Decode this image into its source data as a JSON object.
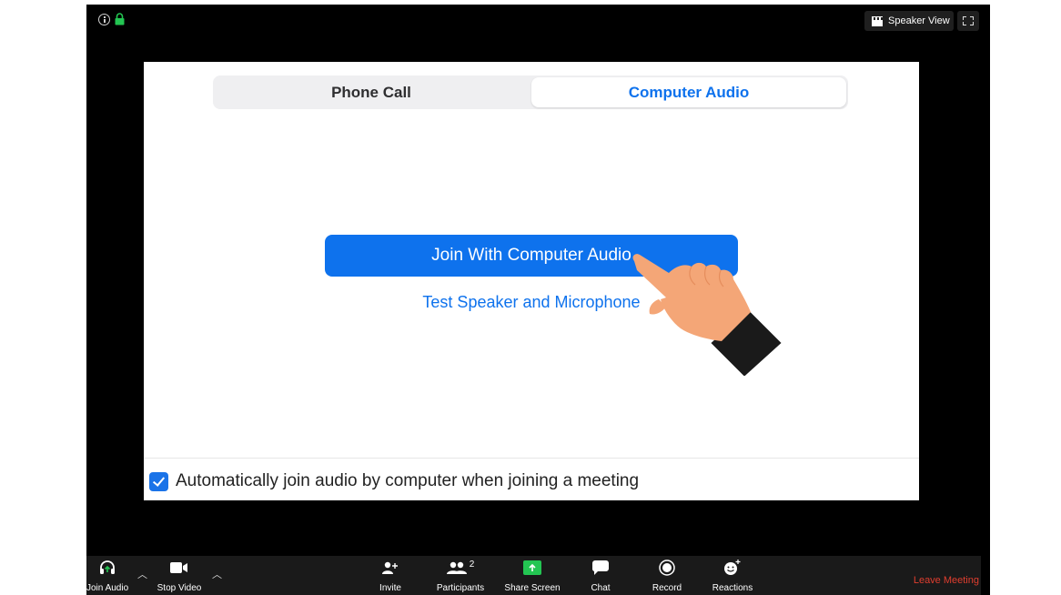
{
  "topbar": {
    "speaker_view_label": "Speaker View"
  },
  "dialog": {
    "tabs": [
      {
        "label": "Phone Call",
        "selected": false
      },
      {
        "label": "Computer Audio",
        "selected": true
      }
    ],
    "join_button_label": "Join With Computer Audio",
    "test_link_label": "Test Speaker and Microphone",
    "auto_join": {
      "checked": true,
      "label": "Automatically join audio by computer when joining a meeting"
    }
  },
  "toolbar": {
    "join_audio_label": "Join Audio",
    "stop_video_label": "Stop Video",
    "invite_label": "Invite",
    "participants_label": "Participants",
    "participants_count": "2",
    "share_screen_label": "Share Screen",
    "chat_label": "Chat",
    "record_label": "Record",
    "reactions_label": "Reactions",
    "leave_label": "Leave Meeting"
  },
  "colors": {
    "accent": "#0e72ed",
    "share_green": "#23c552",
    "leave_red": "#e03e2f",
    "secure_green": "#23c552"
  }
}
